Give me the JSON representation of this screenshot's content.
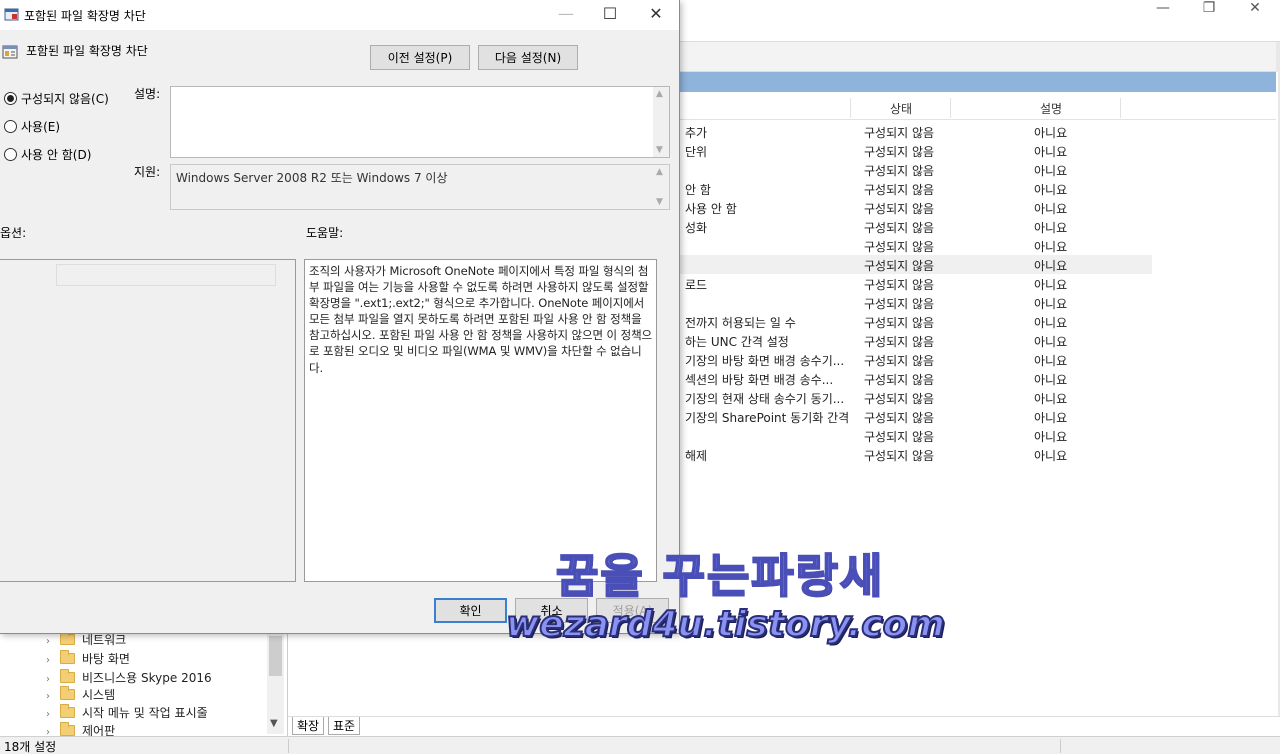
{
  "background_window": {
    "list": {
      "columns": {
        "state": "상태",
        "note": "설명"
      },
      "rows": [
        {
          "name": "추가",
          "state": "구성되지 않음",
          "note": "아니요"
        },
        {
          "name": "단위",
          "state": "구성되지 않음",
          "note": "아니요"
        },
        {
          "name": "",
          "state": "구성되지 않음",
          "note": "아니요"
        },
        {
          "name": "안 함",
          "state": "구성되지 않음",
          "note": "아니요"
        },
        {
          "name": "사용 안 함",
          "state": "구성되지 않음",
          "note": "아니요"
        },
        {
          "name": "성화",
          "state": "구성되지 않음",
          "note": "아니요"
        },
        {
          "name": "",
          "state": "구성되지 않음",
          "note": "아니요"
        },
        {
          "name": "",
          "state": "구성되지 않음",
          "note": "아니요"
        },
        {
          "name": "로드",
          "state": "구성되지 않음",
          "note": "아니요"
        },
        {
          "name": "",
          "state": "구성되지 않음",
          "note": "아니요"
        },
        {
          "name": "전까지 허용되는 일 수",
          "state": "구성되지 않음",
          "note": "아니요"
        },
        {
          "name": "하는 UNC 간격 설정",
          "state": "구성되지 않음",
          "note": "아니요"
        },
        {
          "name": "기장의 바탕 화면 배경 송수기...",
          "state": "구성되지 않음",
          "note": "아니요"
        },
        {
          "name": "섹션의 바탕 화면 배경 송수...",
          "state": "구성되지 않음",
          "note": "아니요"
        },
        {
          "name": "기장의 현재 상태 송수기 동기...",
          "state": "구성되지 않음",
          "note": "아니요"
        },
        {
          "name": "기장의 SharePoint 동기화 간격",
          "state": "구성되지 않음",
          "note": "아니요"
        },
        {
          "name": "",
          "state": "구성되지 않음",
          "note": "아니요"
        },
        {
          "name": "해제",
          "state": "구성되지 않음",
          "note": "아니요"
        }
      ]
    },
    "tree": {
      "items": [
        {
          "label": "네트워크"
        },
        {
          "label": "바탕 화면"
        },
        {
          "label": "비즈니스용 Skype 2016"
        },
        {
          "label": "시스템"
        },
        {
          "label": "시작 메뉴 및 작업 표시줄"
        },
        {
          "label": "제어판"
        }
      ]
    },
    "tabs": {
      "extended": "확장",
      "standard": "표준"
    },
    "status": "18개 설정"
  },
  "dialog": {
    "title": "포함된 파일 확장명 차단",
    "policy_name": "포함된 파일 확장명 차단",
    "prev_button": "이전 설정(P)",
    "next_button": "다음 설정(N)",
    "radio": {
      "not_configured": "구성되지 않음(C)",
      "enabled": "사용(E)",
      "disabled": "사용 안 함(D)"
    },
    "comment_label": "설명:",
    "supported_label": "지원:",
    "supported_text": "Windows Server 2008 R2 또는 Windows 7 이상",
    "options_label": "옵션:",
    "help_label": "도움말:",
    "help_text": "조직의 사용자가 Microsoft OneNote 페이지에서 특정 파일 형식의 첨부 파일을 여는 기능을 사용할 수 없도록 하려면 사용하지 않도록 설정할 확장명을 \".ext1;.ext2;\" 형식으로 추가합니다. OneNote 페이지에서 모든 첨부 파일을 열지 못하도록 하려면 포함된 파일 사용 안 함 정책을 참고하십시오. 포함된 파일 사용 안 함 정책을 사용하지 않으면 이 정책으로 포함된 오디오 및 비디오 파일(WMA 및 WMV)을 차단할 수 없습니다.",
    "ok_button": "확인",
    "cancel_button": "취소",
    "apply_button": "적용(A)"
  },
  "watermark": {
    "title": "꿈을 꾸는파랑새",
    "url": "wezard4u.tistory.com"
  }
}
